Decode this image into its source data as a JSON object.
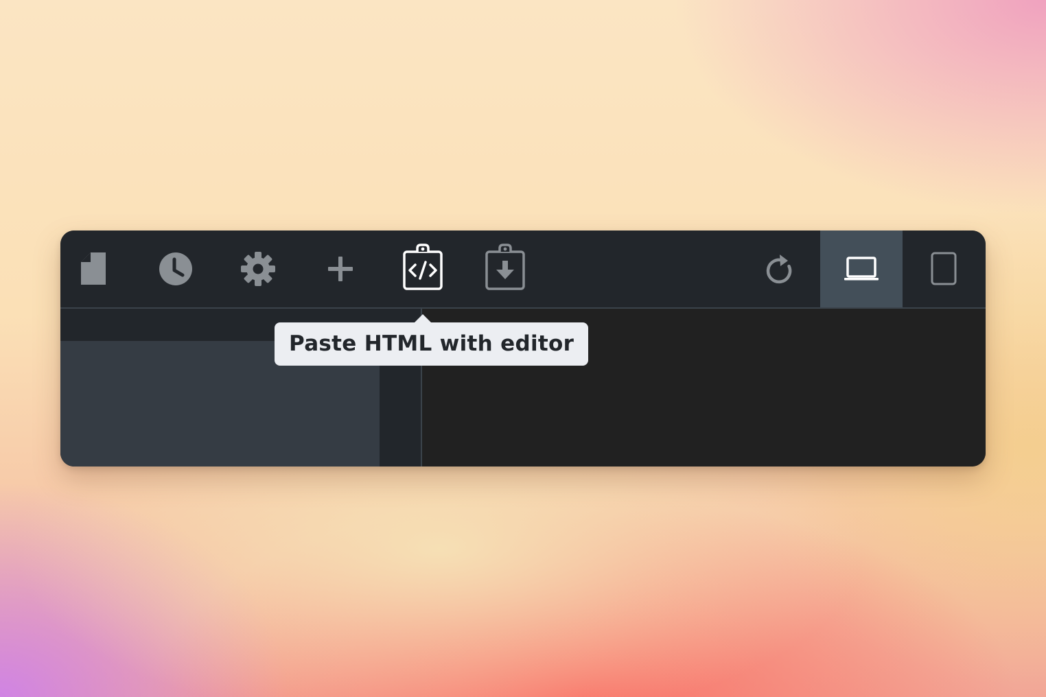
{
  "toolbar": {
    "buttons": [
      {
        "id": "new-file",
        "icon": "file-icon",
        "tooltip": ""
      },
      {
        "id": "history",
        "icon": "clock-icon",
        "tooltip": ""
      },
      {
        "id": "settings",
        "icon": "gear-icon",
        "tooltip": ""
      },
      {
        "id": "add",
        "icon": "plus-icon",
        "tooltip": ""
      },
      {
        "id": "paste-html-editor",
        "icon": "clipboard-code-icon",
        "tooltip": "Paste HTML with editor",
        "hovered": true
      },
      {
        "id": "paste-import",
        "icon": "clipboard-download-icon",
        "tooltip": ""
      },
      {
        "id": "reload",
        "icon": "reload-icon",
        "tooltip": ""
      },
      {
        "id": "desktop-view",
        "icon": "laptop-icon",
        "tooltip": "",
        "active": true
      },
      {
        "id": "mobile-view",
        "icon": "phone-icon",
        "tooltip": ""
      }
    ]
  },
  "tooltip": {
    "text": "Paste HTML with editor"
  },
  "colors": {
    "toolbar_bg": "#22262b",
    "active_bg": "#434f59",
    "icon_muted": "#8a8f94",
    "icon_bright": "#ffffff",
    "panel_bg": "#353c44",
    "editor_bg": "#212121",
    "tooltip_bg": "#eceef2"
  }
}
